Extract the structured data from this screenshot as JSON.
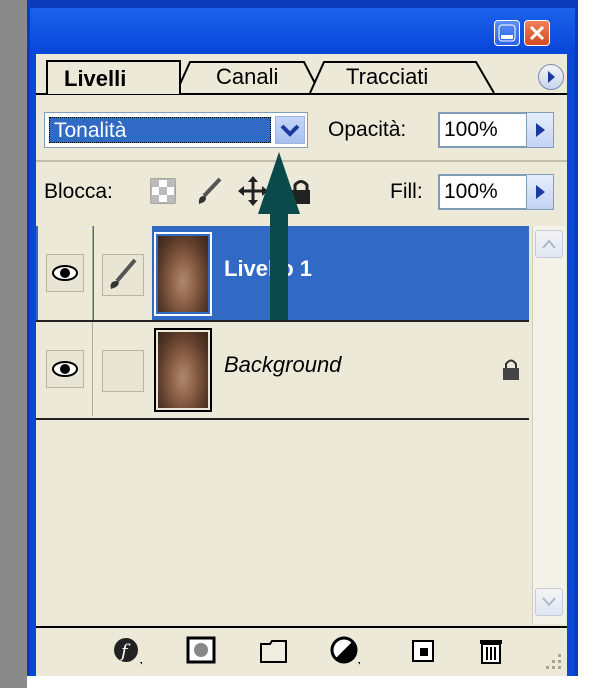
{
  "window": {
    "buttons": {
      "minimize": "minimize",
      "close": "close"
    },
    "colors": {
      "titlebar": "#0a48d6",
      "selection": "#316ac5",
      "panel": "#ece9d8"
    }
  },
  "tabs": [
    {
      "label": "Livelli",
      "active": true
    },
    {
      "label": "Canali",
      "active": false
    },
    {
      "label": "Tracciati",
      "active": false
    }
  ],
  "blend_mode": {
    "value": "Tonalità"
  },
  "opacity": {
    "label": "Opacità:",
    "value": "100%"
  },
  "lock": {
    "label": "Blocca:"
  },
  "fill": {
    "label": "Fill:",
    "value": "100%"
  },
  "layers": [
    {
      "name": "Livello 1",
      "selected": true,
      "visible": true,
      "linked_brush": true,
      "locked": false
    },
    {
      "name": "Background",
      "selected": false,
      "visible": true,
      "linked_brush": false,
      "locked": true
    }
  ],
  "bottom_icons": [
    "layer-style-icon",
    "mask-icon",
    "folder-icon",
    "adjustment-layer-icon",
    "new-layer-icon",
    "trash-icon"
  ]
}
